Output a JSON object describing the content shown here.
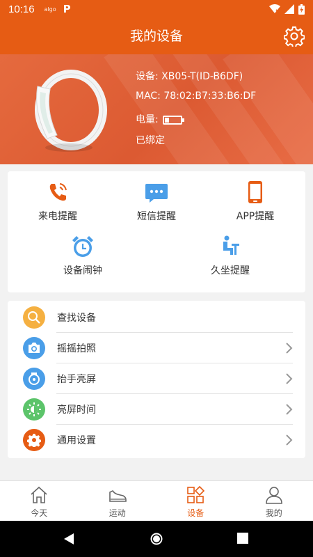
{
  "status_bar": {
    "time": "10:16",
    "small_label": "algo",
    "p_icon": "P",
    "icons": [
      "wifi-x-icon",
      "signal-icon",
      "battery-charging-icon"
    ]
  },
  "header": {
    "title": "我的设备",
    "settings_icon": "gear-icon"
  },
  "device": {
    "model_line": "设备: XB05-T(ID-B6DF)",
    "mac_line": "MAC: 78:02:B7:33:B6:DF",
    "battery_label": "电量:",
    "battery_level": 0.25,
    "bind_status": "已绑定",
    "image": "wristband-image"
  },
  "features": [
    {
      "label": "来电提醒",
      "icon": "incoming-call-icon",
      "color": "#e65c14"
    },
    {
      "label": "短信提醒",
      "icon": "message-icon",
      "color": "#4a9ee8"
    },
    {
      "label": "APP提醒",
      "icon": "smartphone-icon",
      "color": "#e65c14"
    },
    {
      "label": "设备闹钟",
      "icon": "alarm-clock-icon",
      "color": "#4a9ee8"
    },
    {
      "label": "久坐提醒",
      "icon": "sedentary-icon",
      "color": "#4a9ee8"
    }
  ],
  "settings_list": [
    {
      "label": "查找设备",
      "icon": "search-icon",
      "color": "#f5b041",
      "has_arrow": false
    },
    {
      "label": "摇摇拍照",
      "icon": "camera-icon",
      "color": "#4a9ee8",
      "has_arrow": true
    },
    {
      "label": "抬手亮屏",
      "icon": "watch-icon",
      "color": "#4a9ee8",
      "has_arrow": true
    },
    {
      "label": "亮屏时间",
      "icon": "brightness-icon",
      "color": "#5cc46a",
      "has_arrow": true
    },
    {
      "label": "通用设置",
      "icon": "gear-icon",
      "color": "#e65c14",
      "has_arrow": true
    }
  ],
  "tabs": [
    {
      "label": "今天",
      "icon": "home-icon",
      "active": false
    },
    {
      "label": "运动",
      "icon": "shoe-icon",
      "active": false
    },
    {
      "label": "设备",
      "icon": "device-grid-icon",
      "active": true
    },
    {
      "label": "我的",
      "icon": "person-icon",
      "active": false
    }
  ],
  "colors": {
    "accent": "#e65c14",
    "blue": "#4a9ee8",
    "background": "#f2f2f2"
  }
}
